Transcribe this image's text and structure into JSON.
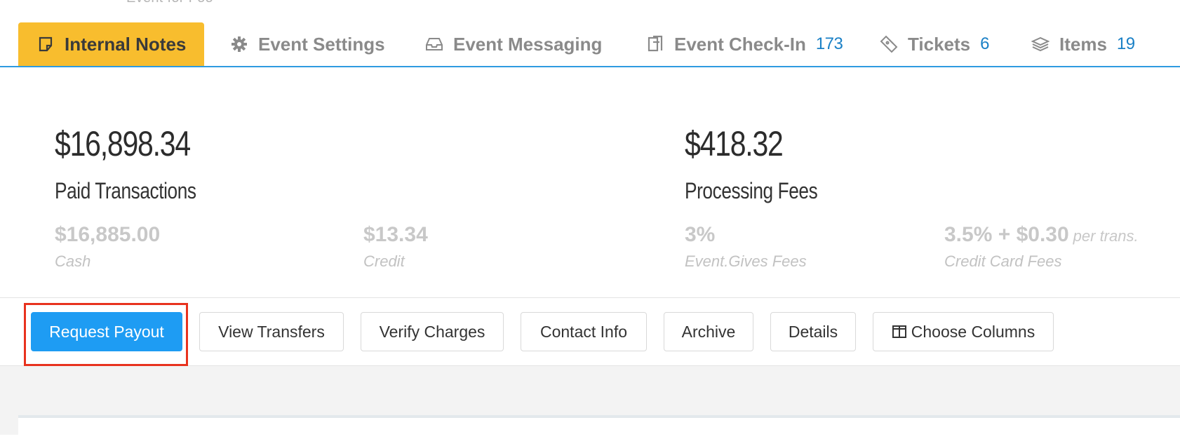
{
  "page_title_fragment": "Event for Foo",
  "tabs": [
    {
      "label": "Internal Notes",
      "icon": "note-icon",
      "count": ""
    },
    {
      "label": "Event Settings",
      "icon": "gear-icon",
      "count": ""
    },
    {
      "label": "Event Messaging",
      "icon": "inbox-icon",
      "count": ""
    },
    {
      "label": "Event Check-In",
      "icon": "clipboard-icon",
      "count": "173"
    },
    {
      "label": "Tickets",
      "icon": "ticket-icon",
      "count": "6"
    },
    {
      "label": "Items",
      "icon": "layers-icon",
      "count": "19"
    }
  ],
  "paid": {
    "total": "$16,898.34",
    "label": "Paid Transactions",
    "cash_value": "$16,885.00",
    "cash_label": "Cash",
    "credit_value": "$13.34",
    "credit_label": "Credit"
  },
  "fees": {
    "total": "$418.32",
    "label": "Processing Fees",
    "eg_value": "3%",
    "eg_label": "Event.Gives Fees",
    "cc_value": "3.5% + $0.30",
    "cc_suffix": "per trans.",
    "cc_label": "Credit Card Fees"
  },
  "actions": {
    "request_payout": "Request Payout",
    "view_transfers": "View Transfers",
    "verify_charges": "Verify Charges",
    "contact_info": "Contact Info",
    "archive": "Archive",
    "details": "Details",
    "choose_columns": "Choose Columns"
  },
  "colors": {
    "active_tab": "#f8bd2e",
    "accent_blue": "#1e9cf3",
    "count_blue": "#1a80c6",
    "highlight_red": "#e8321e"
  }
}
